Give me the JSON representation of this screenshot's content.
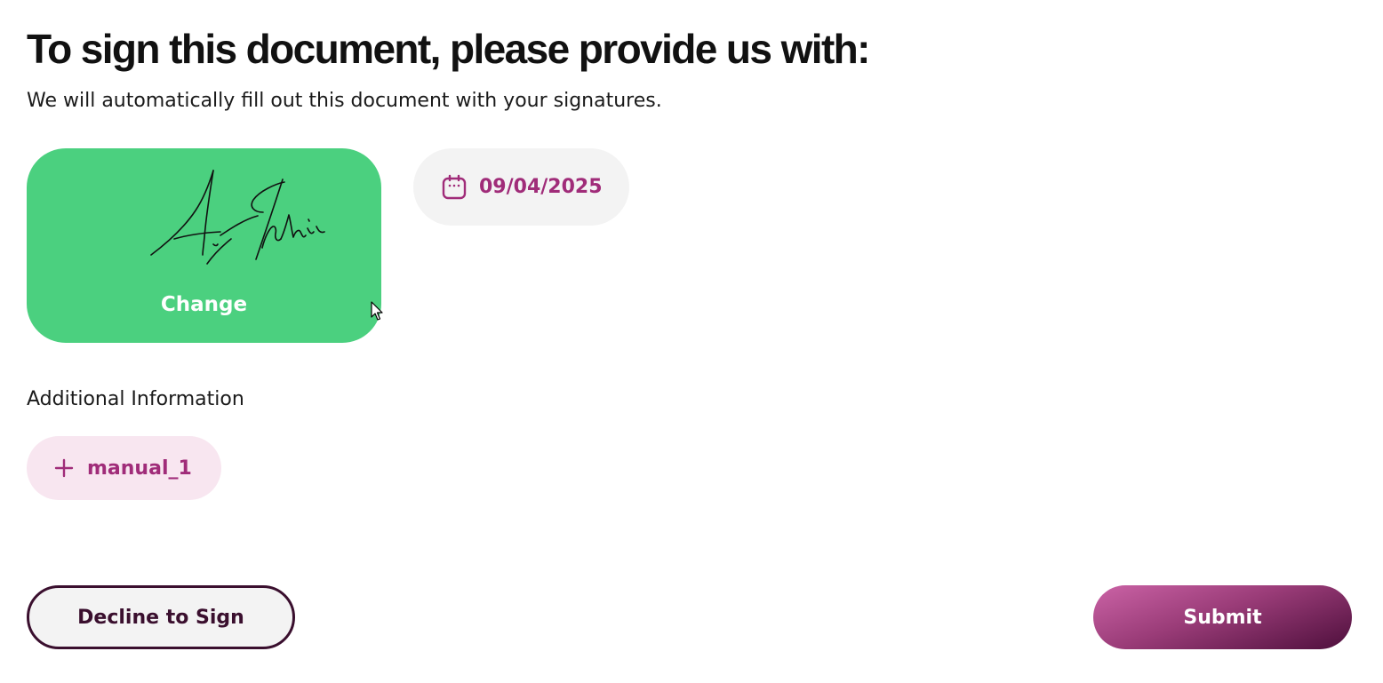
{
  "header": {
    "title": "To sign this document, please provide us with:",
    "subtitle": "We will automatically fill out this document with your signatures."
  },
  "signature": {
    "change_label": "Change",
    "card_color": "#4bd07f"
  },
  "date_field": {
    "icon": "calendar-icon",
    "value": "09/04/2025"
  },
  "additional": {
    "heading": "Additional Information",
    "fields": [
      {
        "icon": "plus-icon",
        "label": "manual_1"
      }
    ]
  },
  "actions": {
    "decline_label": "Decline to Sign",
    "submit_label": "Submit"
  },
  "colors": {
    "accent": "#a02c79",
    "dark_accent": "#3a0f2e",
    "pill_background": "#f3f3f3",
    "add_field_background": "#f8e6f0"
  }
}
